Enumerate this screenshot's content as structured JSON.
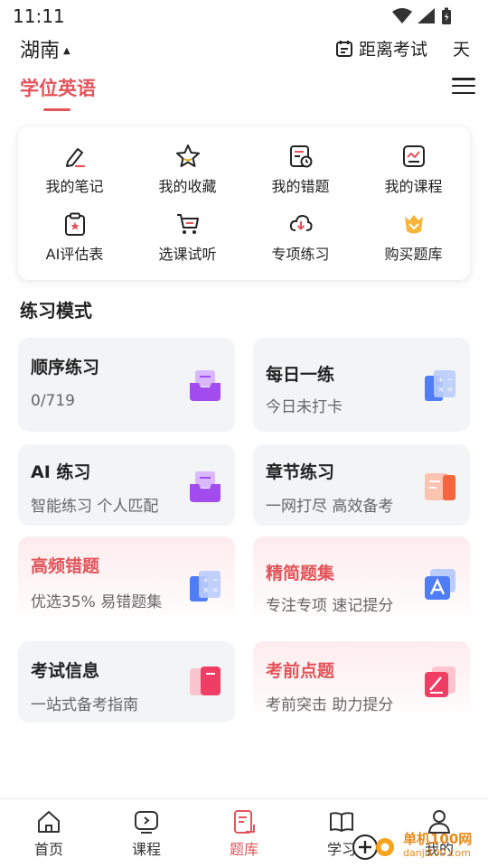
{
  "status_bar": {
    "time": "11:11"
  },
  "header": {
    "region": "湖南",
    "countdown_label": "距离考试",
    "countdown_unit": "天"
  },
  "subject": {
    "label": "学位英语"
  },
  "shortcuts": [
    {
      "label": "我的笔记",
      "icon": "note-edit-icon"
    },
    {
      "label": "我的收藏",
      "icon": "star-icon"
    },
    {
      "label": "我的错题",
      "icon": "error-record-icon"
    },
    {
      "label": "我的课程",
      "icon": "course-chart-icon"
    },
    {
      "label": "AI评估表",
      "icon": "clipboard-icon"
    },
    {
      "label": "选课试听",
      "icon": "cart-icon"
    },
    {
      "label": "专项练习",
      "icon": "cloud-download-icon"
    },
    {
      "label": "购买题库",
      "icon": "crown-badge-icon"
    }
  ],
  "practice": {
    "title": "练习模式",
    "modes": [
      {
        "title": "顺序练习",
        "subtitle": "0/719",
        "icon": "purple-inbox-icon",
        "style": "grey"
      },
      {
        "title": "每日一练",
        "subtitle": "今日未打卡",
        "icon": "blue-calculator-icon",
        "style": "grey"
      },
      {
        "title": "AI 练习",
        "subtitle": "智能练习 个人匹配",
        "icon": "purple-inbox-icon",
        "style": "grey"
      },
      {
        "title": "章节练习",
        "subtitle": "一网打尽 高效备考",
        "icon": "orange-book-icon",
        "style": "grey"
      },
      {
        "title": "高频错题",
        "subtitle": "优选35% 易错题集",
        "icon": "blue-calculator-icon",
        "style": "pink"
      },
      {
        "title": "精简题集",
        "subtitle": "专注专项 速记提分",
        "icon": "blue-app-icon",
        "style": "pink"
      },
      {
        "title": "考试信息",
        "subtitle": "一站式备考指南",
        "icon": "pink-book-icon",
        "style": "grey"
      },
      {
        "title": "考前点题",
        "subtitle": "考前突击 助力提分",
        "icon": "pink-pencil-icon",
        "style": "pink"
      }
    ]
  },
  "bottom_nav": [
    {
      "label": "首页",
      "icon": "home-icon",
      "active": false
    },
    {
      "label": "课程",
      "icon": "play-video-icon",
      "active": false
    },
    {
      "label": "题库",
      "icon": "question-bank-icon",
      "active": true
    },
    {
      "label": "学习",
      "icon": "book-open-icon",
      "active": false
    },
    {
      "label": "我的",
      "icon": "user-icon",
      "active": false
    }
  ],
  "watermark": {
    "line1": "单机100网",
    "line2": "danji100.com"
  },
  "colors": {
    "accent": "#e2545a",
    "card_grey": "#f3f4f6",
    "purple": "#a24cf0",
    "blue": "#4f7df6",
    "orange": "#f5653e"
  }
}
